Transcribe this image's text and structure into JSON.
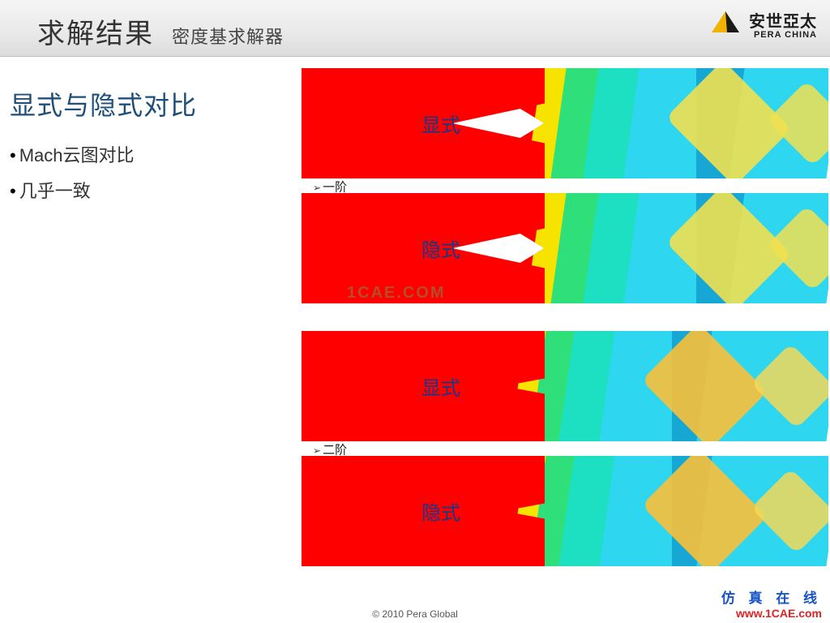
{
  "header": {
    "title_main": "求解结果",
    "title_sub": "密度基求解器",
    "logo_cn": "安世亞太",
    "logo_en": "PERA CHINA"
  },
  "sidebar": {
    "subheading": "显式与隐式对比",
    "bullets": [
      "Mach云图对比",
      "几乎一致"
    ]
  },
  "figures": {
    "pair_labels": [
      "一阶",
      "二阶"
    ],
    "row_labels": {
      "explicit": "显式",
      "implicit": "隐式"
    }
  },
  "watermarks": {
    "cae": "1CAE.COM"
  },
  "footer": {
    "copyright": "© 2010 Pera Global",
    "brand_cn": "仿 真 在 线",
    "brand_url": "www.1CAE.com"
  }
}
